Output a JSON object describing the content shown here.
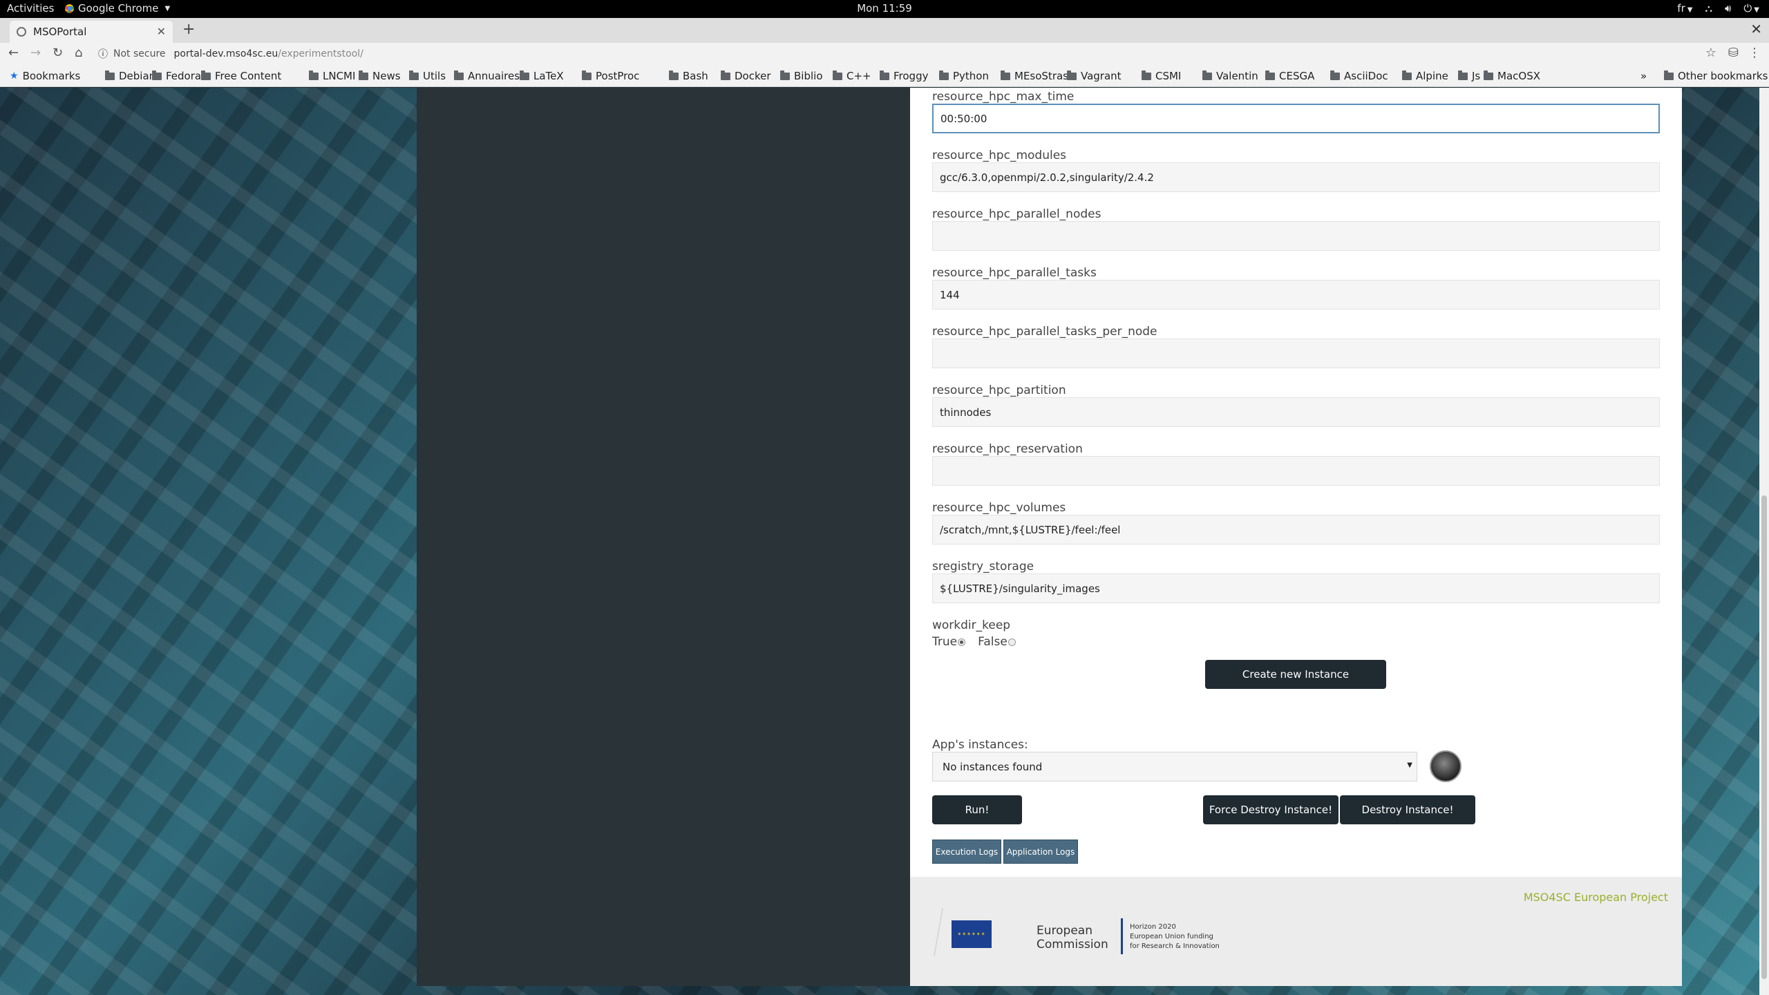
{
  "system": {
    "activities": "Activities",
    "app_name": "Google Chrome",
    "clock": "Mon 11:59",
    "input_lang": "fr"
  },
  "browser": {
    "tab_title": "MSOPortal",
    "url_host": "portal-dev.mso4sc.eu",
    "url_path": "/experimentstool/",
    "security_label": "Not secure",
    "bookmarks": [
      {
        "label": "Bookmarks",
        "icon": "star-icon"
      },
      {
        "label": "Debian"
      },
      {
        "label": "Fedora"
      },
      {
        "label": "Free Content"
      },
      {
        "label": "LNCMI"
      },
      {
        "label": "News"
      },
      {
        "label": "Utils"
      },
      {
        "label": "Annuaires"
      },
      {
        "label": "LaTeX"
      },
      {
        "label": "PostProc"
      },
      {
        "label": "Bash"
      },
      {
        "label": "Docker"
      },
      {
        "label": "Biblio"
      },
      {
        "label": "C++"
      },
      {
        "label": "Froggy"
      },
      {
        "label": "Python"
      },
      {
        "label": "MEsoStras"
      },
      {
        "label": "Vagrant"
      },
      {
        "label": "CSMI"
      },
      {
        "label": "Valentin"
      },
      {
        "label": "CESGA"
      },
      {
        "label": "AsciiDoc"
      },
      {
        "label": "Alpine"
      },
      {
        "label": "Js"
      },
      {
        "label": "MacOSX"
      }
    ],
    "more_bookmarks": "»",
    "other_bookmarks": "Other bookmarks"
  },
  "form": {
    "fields": [
      {
        "label": "resource_hpc_max_time",
        "value": "00:50:00"
      },
      {
        "label": "resource_hpc_modules",
        "value": "gcc/6.3.0,openmpi/2.0.2,singularity/2.4.2"
      },
      {
        "label": "resource_hpc_parallel_nodes",
        "value": ""
      },
      {
        "label": "resource_hpc_parallel_tasks",
        "value": "144"
      },
      {
        "label": "resource_hpc_parallel_tasks_per_node",
        "value": ""
      },
      {
        "label": "resource_hpc_partition",
        "value": "thinnodes"
      },
      {
        "label": "resource_hpc_reservation",
        "value": ""
      },
      {
        "label": "resource_hpc_volumes",
        "value": "/scratch,/mnt,${LUSTRE}/feel:/feel"
      },
      {
        "label": "sregistry_storage",
        "value": "${LUSTRE}/singularity_images"
      }
    ],
    "workdir_keep": {
      "label": "workdir_keep",
      "options": [
        "True",
        "False"
      ],
      "selected": "True"
    },
    "create_button": "Create new Instance"
  },
  "instances": {
    "label": "App's instances:",
    "selected": "No instances found",
    "run_button": "Run!",
    "force_destroy_button": "Force Destroy Instance!",
    "destroy_button": "Destroy Instance!",
    "execution_logs_button": "Execution Logs",
    "application_logs_button": "Application Logs"
  },
  "footer": {
    "project_link": "MSO4SC European Project",
    "ec_line1": "European",
    "ec_line2": "Commission",
    "h2020_line1": "Horizon 2020",
    "h2020_line2": "European Union funding",
    "h2020_line3": "for Research & Innovation"
  }
}
